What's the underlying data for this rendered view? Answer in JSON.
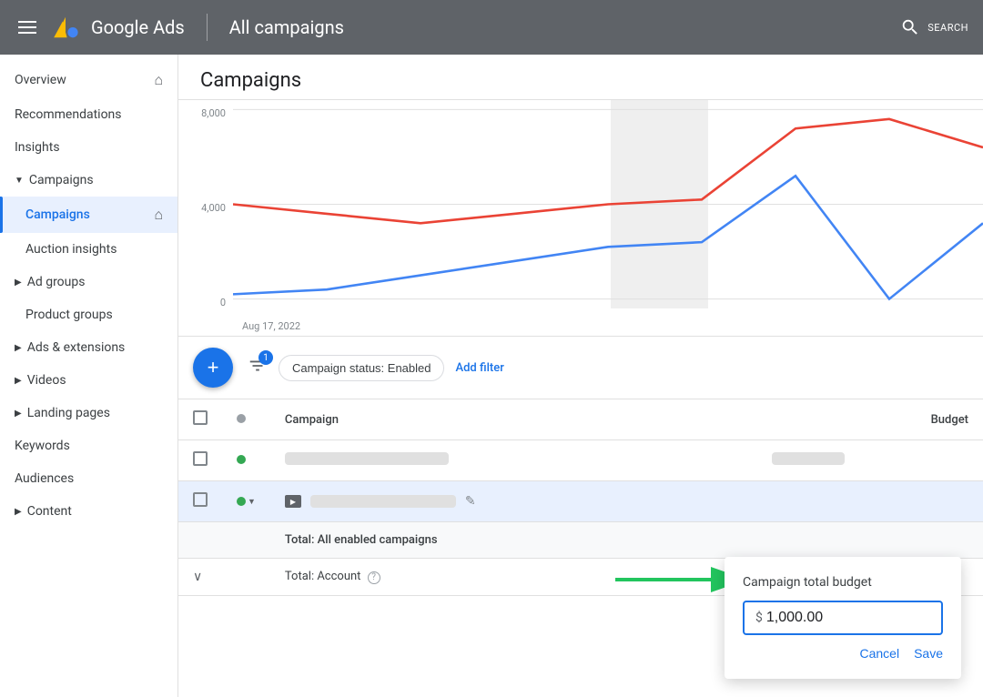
{
  "topbar": {
    "title": "Google Ads",
    "campaign_context": "All campaigns",
    "search_label": "SEARCH"
  },
  "sidebar": {
    "items": [
      {
        "id": "overview",
        "label": "Overview",
        "icon": "home",
        "active": false,
        "indent": 0
      },
      {
        "id": "recommendations",
        "label": "Recommendations",
        "icon": "",
        "active": false,
        "indent": 0
      },
      {
        "id": "insights",
        "label": "Insights",
        "icon": "",
        "active": false,
        "indent": 0
      },
      {
        "id": "campaigns-section",
        "label": "Campaigns",
        "icon": "",
        "active": false,
        "isSection": true,
        "indent": 0
      },
      {
        "id": "campaigns",
        "label": "Campaigns",
        "icon": "home",
        "active": true,
        "indent": 1
      },
      {
        "id": "auction-insights",
        "label": "Auction insights",
        "icon": "",
        "active": false,
        "indent": 1
      },
      {
        "id": "ad-groups",
        "label": "Ad groups",
        "icon": "",
        "active": false,
        "isSection": true,
        "indent": 0
      },
      {
        "id": "product-groups",
        "label": "Product groups",
        "icon": "",
        "active": false,
        "indent": 1
      },
      {
        "id": "ads-extensions",
        "label": "Ads & extensions",
        "icon": "",
        "active": false,
        "isSection": true,
        "indent": 0
      },
      {
        "id": "videos",
        "label": "Videos",
        "icon": "",
        "active": false,
        "isSection": true,
        "indent": 0
      },
      {
        "id": "landing-pages",
        "label": "Landing pages",
        "icon": "",
        "active": false,
        "isSection": true,
        "indent": 0
      },
      {
        "id": "keywords",
        "label": "Keywords",
        "icon": "",
        "active": false,
        "indent": 0
      },
      {
        "id": "audiences",
        "label": "Audiences",
        "icon": "",
        "active": false,
        "indent": 0
      },
      {
        "id": "content",
        "label": "Content",
        "icon": "",
        "active": false,
        "isSection": true,
        "indent": 0
      }
    ]
  },
  "page": {
    "title": "Campaigns"
  },
  "chart": {
    "yaxis": [
      "8,000",
      "4,000",
      "0"
    ],
    "xaxis_label": "Aug 17, 2022",
    "highlight_start_pct": 47,
    "highlight_width_pct": 12
  },
  "toolbar": {
    "filter_badge": "1",
    "status_chip_label": "Campaign status: Enabled",
    "add_filter_label": "Add filter"
  },
  "table": {
    "headers": [
      "",
      "",
      "Campaign",
      "Budget"
    ],
    "rows": [
      {
        "id": "row1",
        "status": "green",
        "name_skeleton": true,
        "budget_skeleton": true,
        "type": "search"
      },
      {
        "id": "row2",
        "status": "green",
        "name_skeleton": true,
        "budget_skeleton": false,
        "type": "video",
        "has_edit": true
      }
    ],
    "total_row": {
      "label": "Total: All enabled campaigns"
    },
    "account_row": {
      "label": "Total: Account",
      "has_info": true
    }
  },
  "budget_popup": {
    "title": "Campaign total budget",
    "value": "1,000.00",
    "currency_symbol": "$ ",
    "cancel_label": "Cancel",
    "save_label": "Save"
  }
}
